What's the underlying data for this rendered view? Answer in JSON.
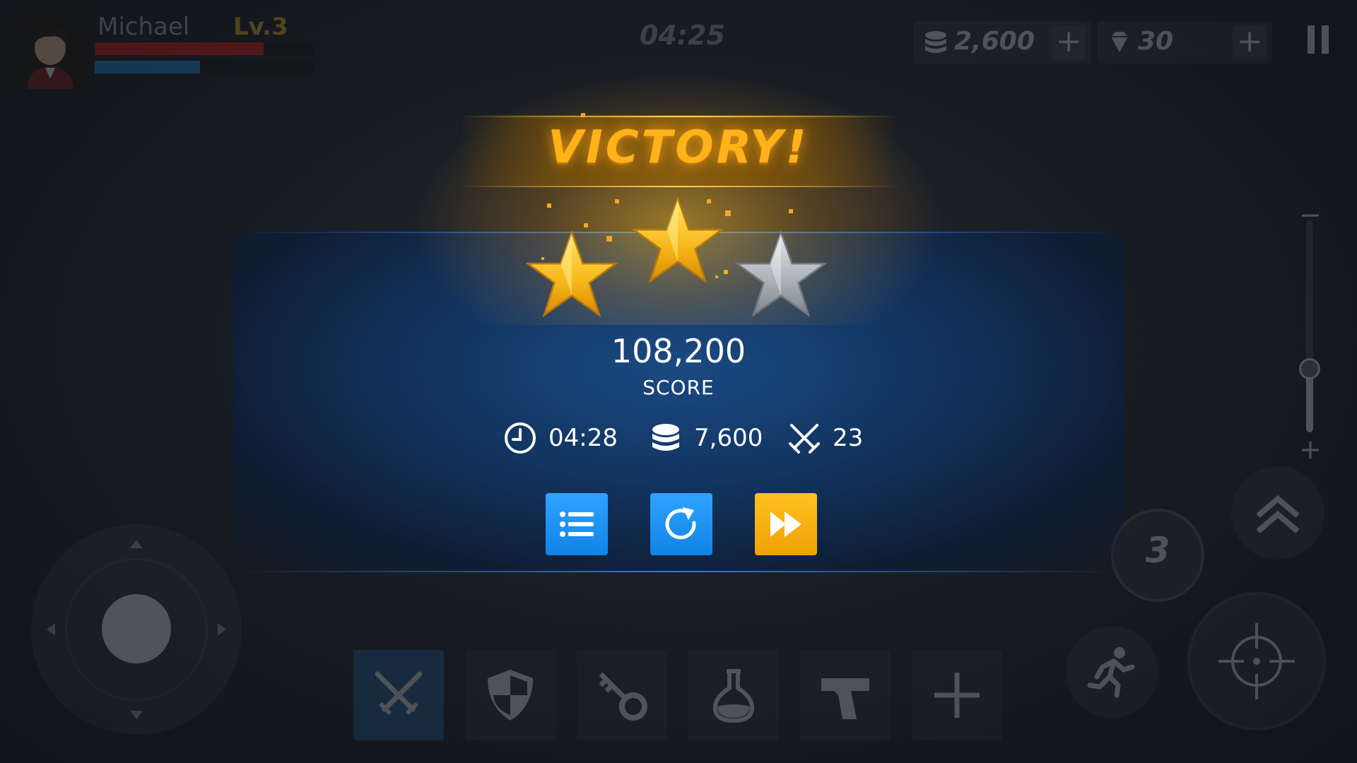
{
  "hud": {
    "player_name": "Michael",
    "player_level": "Lv.3",
    "hp_fraction": 0.77,
    "mp_fraction": 0.48,
    "timer": "04:25",
    "coins": "2,600",
    "gems": "30",
    "coins_plus": "+",
    "gems_plus": "+"
  },
  "slider": {
    "minus": "−",
    "plus": "+",
    "level": 0.3
  },
  "skills": [
    {
      "icon": "crossed-swords-icon",
      "active": true
    },
    {
      "icon": "shield-icon",
      "active": false
    },
    {
      "icon": "key-icon",
      "active": false
    },
    {
      "icon": "potion-flask-icon",
      "active": false
    },
    {
      "icon": "pistol-icon",
      "active": false
    },
    {
      "icon": "plus-icon",
      "active": false
    }
  ],
  "grenade_count": "3",
  "result": {
    "title": "VICTORY!",
    "stars_earned": 2,
    "stars_total": 3,
    "score": "108,200",
    "score_label": "SCORE",
    "time": "04:28",
    "coins": "7,600",
    "kills": "23"
  },
  "colors": {
    "victory_gold": "#ffb21a",
    "button_blue": "#1a90f2",
    "button_gold": "#f5ad10",
    "panel_blue": "#123460"
  }
}
